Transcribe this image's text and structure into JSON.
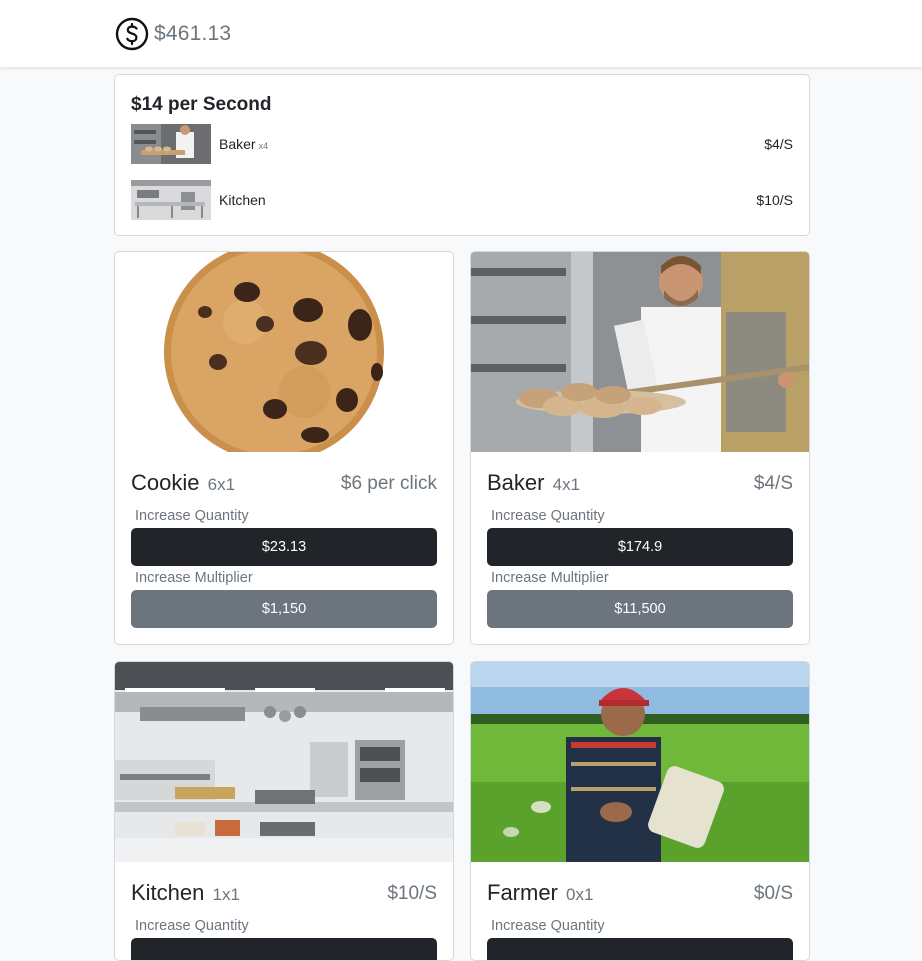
{
  "header": {
    "balance": "$461.13",
    "icon": "dollar-circle-icon"
  },
  "summary": {
    "title": "$14 per Second",
    "rows": [
      {
        "name": "Baker",
        "multiplier": "x4",
        "rate": "$4/S",
        "image": "baker-thumbnail"
      },
      {
        "name": "Kitchen",
        "multiplier": "",
        "rate": "$10/S",
        "image": "kitchen-thumbnail"
      }
    ]
  },
  "items": [
    {
      "name": "Cookie",
      "count": "6x1",
      "rate": "$6 per click",
      "qty_label": "Increase Quantity",
      "qty_price": "$23.13",
      "mult_label": "Increase Multiplier",
      "mult_price": "$1,150",
      "image": "cookie-image"
    },
    {
      "name": "Baker",
      "count": "4x1",
      "rate": "$4/S",
      "qty_label": "Increase Quantity",
      "qty_price": "$174.9",
      "mult_label": "Increase Multiplier",
      "mult_price": "$11,500",
      "image": "baker-image"
    },
    {
      "name": "Kitchen",
      "count": "1x1",
      "rate": "$10/S",
      "qty_label": "Increase Quantity",
      "qty_price": "",
      "mult_label": "",
      "mult_price": "",
      "image": "kitchen-image"
    },
    {
      "name": "Farmer",
      "count": "0x1",
      "rate": "$0/S",
      "qty_label": "Increase Quantity",
      "qty_price": "",
      "mult_label": "",
      "mult_price": "",
      "image": "farmer-image"
    }
  ],
  "colors": {
    "dark_button": "#212529",
    "gray_button": "#6c757d",
    "muted_text": "#6c757d",
    "background": "#f8f9fa"
  }
}
